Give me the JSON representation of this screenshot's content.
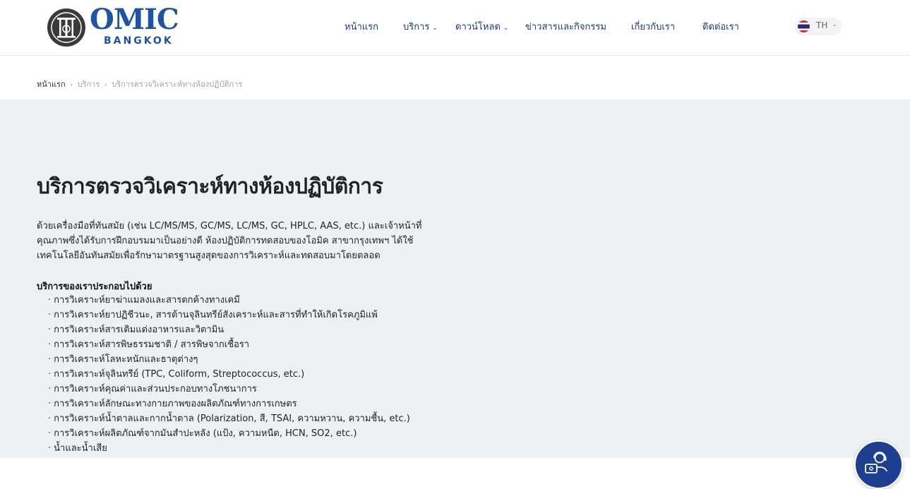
{
  "brand": {
    "name": "OMIC",
    "sub": "BANGKOK",
    "primary_color": "#1f53a3"
  },
  "nav": {
    "items": [
      {
        "label": "หน้าแรก"
      },
      {
        "label": "บริการ"
      },
      {
        "label": "ดาวน์โหลด"
      },
      {
        "label": "ข่าวสารและกิจกรรม"
      },
      {
        "label": "เกี่ยวกับเรา"
      },
      {
        "label": "ติดต่อเรา"
      }
    ],
    "lang": "TH"
  },
  "breadcrumb": {
    "home": "หน้าแรก",
    "section": "บริการ",
    "current": "บริการตรวจวิเคราะห์ทางห้องปฏิบัติการ"
  },
  "main": {
    "title": "บริการตรวจวิเคราะห์ทางห้องปฏิบัติการ",
    "intro_lines": [
      "ด้วยเครื่องมือที่ทันสมัย (เช่น LC/MS/MS, GC/MS, LC/MS, GC, HPLC, AAS, etc.) และเจ้าหน้าที่",
      "คุณภาพซึ่งได้รับการฝึกอบรมมาเป็นอย่างดี ห้องปฏิบัติการทดสอบของโอมิค สาขากรุงเทพฯ ได้ใช้",
      "เทคโนโลยีอันทันสมัยเพื่อรักษามาตรฐานสูงสุดของการวิเคราะห์และทดสอบมาโดยตลอด"
    ],
    "services_heading": "บริการของเราประกอบไปด้วย",
    "services": [
      "การวิเคราะห์ยาฆ่าแมลงและสารตกค้างทางเคมี",
      "การวิเคราะห์ยาปฏิชีวนะ, สารต้านจุลินทรีย์สังเคราะห์และสารที่ทำให้เกิดโรคภูมิแพ้",
      "การวิเคราะห์สารเติมแต่งอาหารและวิตามิน",
      "การวิเคราะห์สารพิษธรรมชาติ / สารพิษจากเชื้อรา",
      "การวิเคราะห์โลหะหนักและธาตุต่างๆ",
      "การวิเคราะห์จุลินทรีย์ (TPC, Coliform, Streptococcus, etc.)",
      "การวิเคราะห์คุณค่าและส่วนประกอบทางโภชนาการ",
      "การวิเคราะห์ลักษณะทางกายภาพของผลิตภัณฑ์ทางการเกษตร",
      "การวิเคราะห์น้ำตาลและกากน้ำตาล (Polarization, สี, TSAI, ความหวาน, ความชื้น, etc.)",
      "การวิเคราะห์ผลิตภัณฑ์จากมันสำปะหลัง (แป้ง, ความหนืด, HCN, SO2, etc.)",
      "น้ำและน้ำเสีย"
    ]
  },
  "icons": {
    "nav_dropdown": "chevron-down-icon",
    "chat": "chat-agent-icon",
    "flag": "thai-flag-icon"
  }
}
